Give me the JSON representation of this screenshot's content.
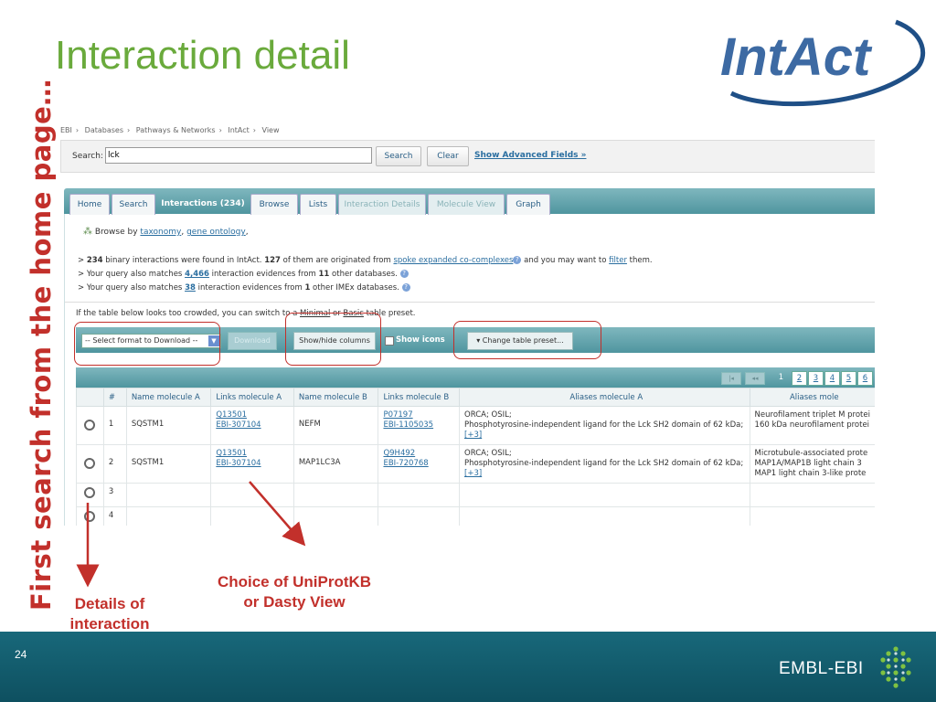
{
  "slide": {
    "title": "Interaction detail",
    "vertical_caption": "First search from the home page…",
    "page_number": "24",
    "logo_text": "IntAct",
    "footer_brand": "EMBL-EBI"
  },
  "breadcrumb": [
    "EBI",
    "Databases",
    "Pathways & Networks",
    "IntAct",
    "View"
  ],
  "search": {
    "label": "Search:",
    "value": "lck",
    "search_button": "Search",
    "clear_button": "Clear",
    "advanced_link": "Show Advanced Fields »"
  },
  "tabs": [
    {
      "label": "Home"
    },
    {
      "label": "Search"
    },
    {
      "label": "Interactions (234)"
    },
    {
      "label": "Browse"
    },
    {
      "label": "Lists"
    },
    {
      "label": "Interaction Details"
    },
    {
      "label": "Molecule View"
    },
    {
      "label": "Graph"
    }
  ],
  "browse": {
    "prefix": "Browse by",
    "taxonomy": "taxonomy",
    "sep": ",",
    "go": "gene ontology",
    "end": ","
  },
  "info": {
    "l1_a": "> ",
    "l1_b": "234",
    "l1_c": " binary interactions were found in IntAct. ",
    "l1_d": "127",
    "l1_e": " of them are originated from ",
    "l1_link": "spoke expanded co-complexes",
    "l1_f": " and you may want to ",
    "l1_filter": "filter",
    "l1_g": "  them.",
    "l2_a": "> Your query also matches ",
    "l2_link": "4,466",
    "l2_b": " interaction evidences from ",
    "l2_c": "11",
    "l2_d": " other databases.",
    "l3_a": "> Your query also matches ",
    "l3_link": "38",
    "l3_b": " interaction evidences from ",
    "l3_c": "1",
    "l3_d": " other IMEx databases."
  },
  "preset": {
    "a": "If the table below looks too crowded, you can switch to a ",
    "minimal": "Minimal",
    "b": " or ",
    "basic": "Basic",
    "c": " table preset."
  },
  "toolbar": {
    "format_select": "-- Select format to Download --",
    "download": "Download",
    "show_hide": "Show/hide columns",
    "show_icons": "Show icons",
    "change_preset": "Change table preset..."
  },
  "pager": {
    "first": "|◂",
    "prev": "◂◂",
    "current": "1",
    "pages": [
      "2",
      "3",
      "4",
      "5",
      "6"
    ]
  },
  "table": {
    "headers": [
      "",
      "#",
      "Name molecule A",
      "Links molecule A",
      "Name molecule B",
      "Links molecule B",
      "Aliases molecule A",
      "Aliases mole"
    ],
    "rows": [
      {
        "num": "1",
        "name_a": "SQSTM1",
        "link_a1": "Q13501",
        "link_a2": "EBI-307104",
        "name_b": "NEFM",
        "link_b1": "P07197",
        "link_b2": "EBI-1105035",
        "alias_a1": "ORCA; OSIL;",
        "alias_a2": "Phosphotyrosine-independent ligand for the Lck SH2 domain of 62 kDa;",
        "alias_a3": "[+3]",
        "alias_b1": "Neurofilament triplet M protei",
        "alias_b2": "160 kDa neurofilament protei"
      },
      {
        "num": "2",
        "name_a": "SQSTM1",
        "link_a1": "Q13501",
        "link_a2": "EBI-307104",
        "name_b": "MAP1LC3A",
        "link_b1": "Q9H492",
        "link_b2": "EBI-720768",
        "alias_a1": "ORCA; OSIL;",
        "alias_a2": "Phosphotyrosine-independent ligand for the Lck SH2 domain of 62 kDa;",
        "alias_a3": "[+3]",
        "alias_b1": "Microtubule-associated prote",
        "alias_b2": "MAP1A/MAP1B light chain 3",
        "alias_b3": "MAP1 light chain 3-like prote"
      },
      {
        "num": "3"
      },
      {
        "num": "4"
      }
    ]
  },
  "callouts": {
    "details_1": "Details of",
    "details_2": "interaction",
    "uniprot_1": "Choice of UniProtKB",
    "uniprot_2": "or Dasty View"
  },
  "colors": {
    "title_green": "#6aaa3c",
    "annotation_red": "#c2302b",
    "teal": "#4f959f",
    "footer": "#0e5060"
  }
}
